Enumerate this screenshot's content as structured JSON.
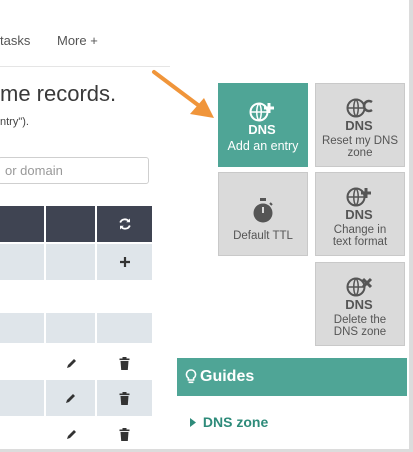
{
  "nav": {
    "tasks_label": "tasks",
    "more_label": "More +"
  },
  "page": {
    "title": "me records.",
    "subtitle": "ntry\").",
    "search_placeholder": "or domain"
  },
  "actions": {
    "add_entry": "Add an entry",
    "reset_zone": [
      "Reset my DNS",
      "zone"
    ],
    "default_ttl": "Default TTL",
    "change_text": [
      "Change in",
      "text format"
    ],
    "delete_zone": [
      "Delete the",
      "DNS zone"
    ],
    "icon_text": "DNS"
  },
  "guides": {
    "title": "Guides",
    "link": "DNS zone"
  },
  "colors": {
    "accent": "#4fa596",
    "table_header": "#3f4452",
    "table_alt": "#dfe5ea",
    "tile": "#dadada",
    "arrow": "#f0953a"
  },
  "icons": [
    "refresh-icon",
    "plus-icon",
    "edit-icon",
    "delete-icon",
    "lightbulb-icon",
    "chevron-right-icon"
  ]
}
